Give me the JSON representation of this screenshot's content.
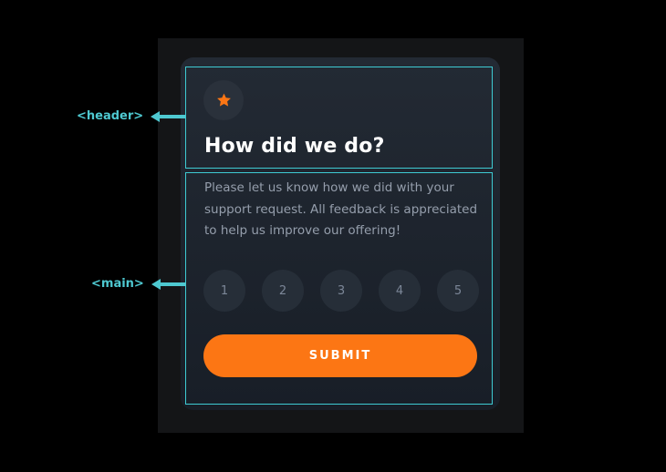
{
  "annotations": {
    "header": "<header>",
    "main": "<main>"
  },
  "card": {
    "icon": "star-icon",
    "title": "How did we do?",
    "description": "Please let us know how we did with your support request. All feedback is appreciated to help us improve our offering!",
    "ratings": [
      "1",
      "2",
      "3",
      "4",
      "5"
    ],
    "submit_label": "SUBMIT"
  },
  "colors": {
    "accent": "#fc7614",
    "outline": "#3ecbd3",
    "card_bg": "#1f2630",
    "rating_bg": "#262e38",
    "muted_text": "#959eac"
  }
}
